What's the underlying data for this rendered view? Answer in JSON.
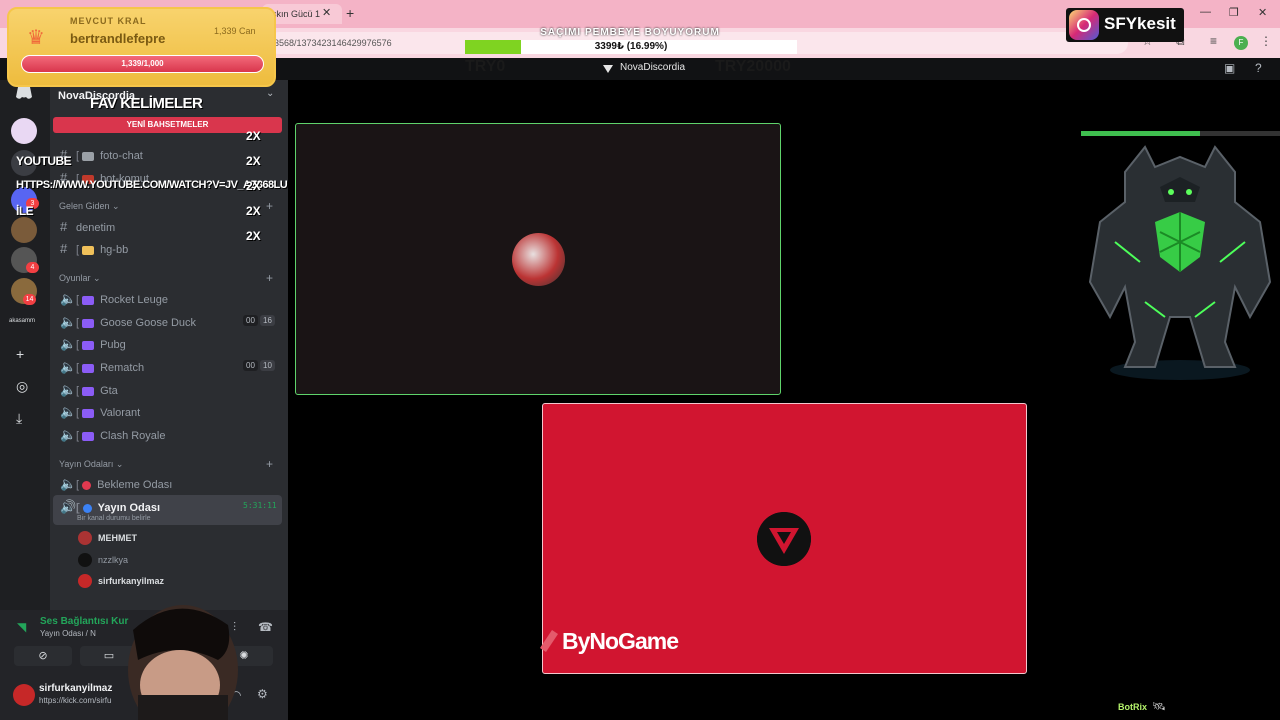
{
  "browser": {
    "tab_title": "şkın Gücü 1",
    "url": "3568/1373423146429976576",
    "profile_initial": "F"
  },
  "goal": {
    "title": "SAÇIMI PEMBEYE BOYUYORUM",
    "amount": "3399₺ (16.99%)",
    "progress": 0.1699
  },
  "discord": {
    "server_name": "NovaDiscordia",
    "try_left": "TRY0",
    "try_right": "TRY20000",
    "sidebar_server": "NovaDiscordia",
    "categories": {
      "gelen_giden": "Gelen Giden",
      "oyunlar": "Oyunlar",
      "yayin_odalari": "Yayın Odaları"
    },
    "text_channels": [
      {
        "label": "foto-chat"
      },
      {
        "label": "bot-komut"
      },
      {
        "label": "denetim"
      },
      {
        "label": "hg-bb"
      }
    ],
    "voice_channels": [
      {
        "label": "Rocket Leuge"
      },
      {
        "label": "Goose Goose Duck",
        "count_a": "00",
        "count_b": "16"
      },
      {
        "label": "Pubg"
      },
      {
        "label": "Rematch",
        "count_a": "00",
        "count_b": "10"
      },
      {
        "label": "Gta"
      },
      {
        "label": "Valorant"
      },
      {
        "label": "Clash Royale"
      }
    ],
    "stream_rooms": [
      {
        "label": "Bekleme Odası"
      },
      {
        "label": "Yayın Odası",
        "time": "5:31:11",
        "status": "Bir kanal durumu belirle"
      }
    ],
    "voice_users": [
      "MEHMET",
      "nzzlkya",
      "sirfurkanyilmaz"
    ],
    "rail_badges": [
      "3",
      "4",
      "14"
    ],
    "rail_small_label": "akasamm"
  },
  "voice_panel": {
    "status": "Ses Bağlantısı Kur",
    "sub": "Yayın Odası / N",
    "username": "sirfurkanyilmaz",
    "user_sub": "https://kick.com/sirfu"
  },
  "kral": {
    "label": "MEVCUT KRAL",
    "name": "bertrandlefepre",
    "can": "1,339 Can",
    "bar_text": "1,339/1,000"
  },
  "fav": {
    "title": "FAV KELİMELER",
    "tab": "YENİ BAHSETMELER",
    "rows": [
      {
        "text": "",
        "mult": "2X"
      },
      {
        "text": "",
        "mult": "2X"
      },
      {
        "text": "YOUTUBE",
        "mult": ""
      },
      {
        "text": "HTTPS://WWW.YOUTUBE.COM/WATCH?V=JV_AZ368LU",
        "mult": "2X"
      },
      {
        "text": "İLE",
        "mult": "2X"
      },
      {
        "text": "",
        "mult": "2X"
      }
    ]
  },
  "stage": {
    "sponsor": "ByNoGame",
    "boss_hp": 0.6
  },
  "social": {
    "instagram": "SFYkesit"
  },
  "bot": {
    "name": "BotRix"
  },
  "colors": {
    "discord_bg": "#2b2d31",
    "rail_bg": "#1e1f22",
    "goal_fill": "#7fd321",
    "tile_border": "#5fd36b",
    "sponsor_red": "#d11530",
    "kral_gold": "#f6c64a"
  },
  "icons": [
    "discord-icon",
    "plus-icon",
    "compass-icon",
    "download-icon",
    "hash-icon",
    "speaker-icon",
    "mic-icon",
    "headphones-icon",
    "gear-icon",
    "instagram-icon",
    "crown-icon"
  ]
}
